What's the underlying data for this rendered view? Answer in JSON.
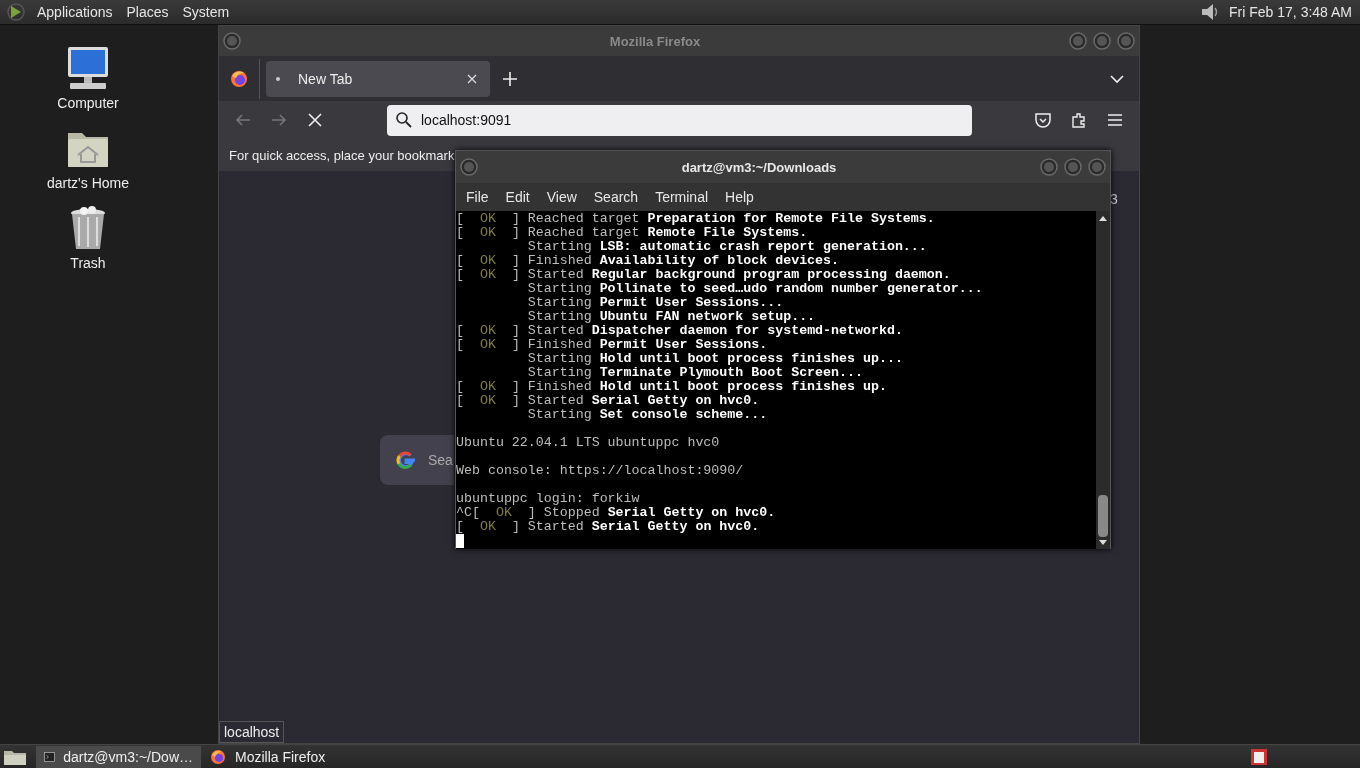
{
  "top_panel": {
    "menus": [
      "Applications",
      "Places",
      "System"
    ],
    "clock": "Fri Feb 17,  3:48 AM"
  },
  "desktop_icons": [
    {
      "label": "Computer",
      "kind": "computer"
    },
    {
      "label": "dartz's Home",
      "kind": "home"
    },
    {
      "label": "Trash",
      "kind": "trash"
    }
  ],
  "firefox": {
    "title": "Mozilla Firefox",
    "tabs": [
      {
        "label": "New Tab",
        "selected": true
      }
    ],
    "url": "localhost:9091",
    "bookmarks_hint": "For quick access, place your bookmark",
    "search_placeholder": "Sea",
    "partial_text": "3",
    "status_tooltip": "localhost"
  },
  "terminal": {
    "title": "dartz@vm3:~/Downloads",
    "menus": [
      "File",
      "Edit",
      "View",
      "Search",
      "Terminal",
      "Help"
    ],
    "lines": [
      {
        "kind": "text",
        "lead": "[  ",
        "status": "OK",
        "verb": "  ] Reached target ",
        "unit": "Preparation for Remote File Systems."
      },
      {
        "kind": "text",
        "lead": "[  ",
        "status": "OK",
        "verb": "  ] Reached target ",
        "unit": "Remote File Systems."
      },
      {
        "kind": "text",
        "verb": "         Starting ",
        "unit": "LSB: automatic crash report generation..."
      },
      {
        "kind": "text",
        "lead": "[  ",
        "status": "OK",
        "verb": "  ] Finished ",
        "unit": "Availability of block devices."
      },
      {
        "kind": "text",
        "lead": "[  ",
        "status": "OK",
        "verb": "  ] Started ",
        "unit": "Regular background program processing daemon."
      },
      {
        "kind": "text",
        "verb": "         Starting ",
        "unit": "Pollinate to seed…udo random number generator..."
      },
      {
        "kind": "text",
        "verb": "         Starting ",
        "unit": "Permit User Sessions..."
      },
      {
        "kind": "text",
        "verb": "         Starting ",
        "unit": "Ubuntu FAN network setup..."
      },
      {
        "kind": "text",
        "lead": "[  ",
        "status": "OK",
        "verb": "  ] Started ",
        "unit": "Dispatcher daemon for systemd-networkd."
      },
      {
        "kind": "text",
        "lead": "[  ",
        "status": "OK",
        "verb": "  ] Finished ",
        "unit": "Permit User Sessions."
      },
      {
        "kind": "text",
        "verb": "         Starting ",
        "unit": "Hold until boot process finishes up..."
      },
      {
        "kind": "text",
        "verb": "         Starting ",
        "unit": "Terminate Plymouth Boot Screen..."
      },
      {
        "kind": "text",
        "lead": "[  ",
        "status": "OK",
        "verb": "  ] Finished ",
        "unit": "Hold until boot process finishes up."
      },
      {
        "kind": "text",
        "lead": "[  ",
        "status": "OK",
        "verb": "  ] Started ",
        "unit": "Serial Getty on hvc0."
      },
      {
        "kind": "text",
        "verb": "         Starting ",
        "unit": "Set console scheme..."
      },
      {
        "kind": "blank"
      },
      {
        "kind": "text",
        "verb": "Ubuntu 22.04.1 LTS ubuntuppc hvc0"
      },
      {
        "kind": "blank"
      },
      {
        "kind": "text",
        "verb": "Web console: https://localhost:9090/"
      },
      {
        "kind": "blank"
      },
      {
        "kind": "text",
        "verb": "ubuntuppc login: forkiw"
      },
      {
        "kind": "text",
        "lead": "^C[  ",
        "status": "OK",
        "verb": "  ] Stopped ",
        "unit": "Serial Getty on hvc0."
      },
      {
        "kind": "text",
        "lead": "[  ",
        "status": "OK",
        "verb": "  ] Started ",
        "unit": "Serial Getty on hvc0."
      },
      {
        "kind": "cursor"
      }
    ]
  },
  "taskbar": {
    "tasks": [
      {
        "label": "dartz@vm3:~/Dow…",
        "kind": "terminal",
        "selected": true
      },
      {
        "label": "Mozilla Firefox",
        "kind": "firefox",
        "selected": false
      }
    ]
  }
}
